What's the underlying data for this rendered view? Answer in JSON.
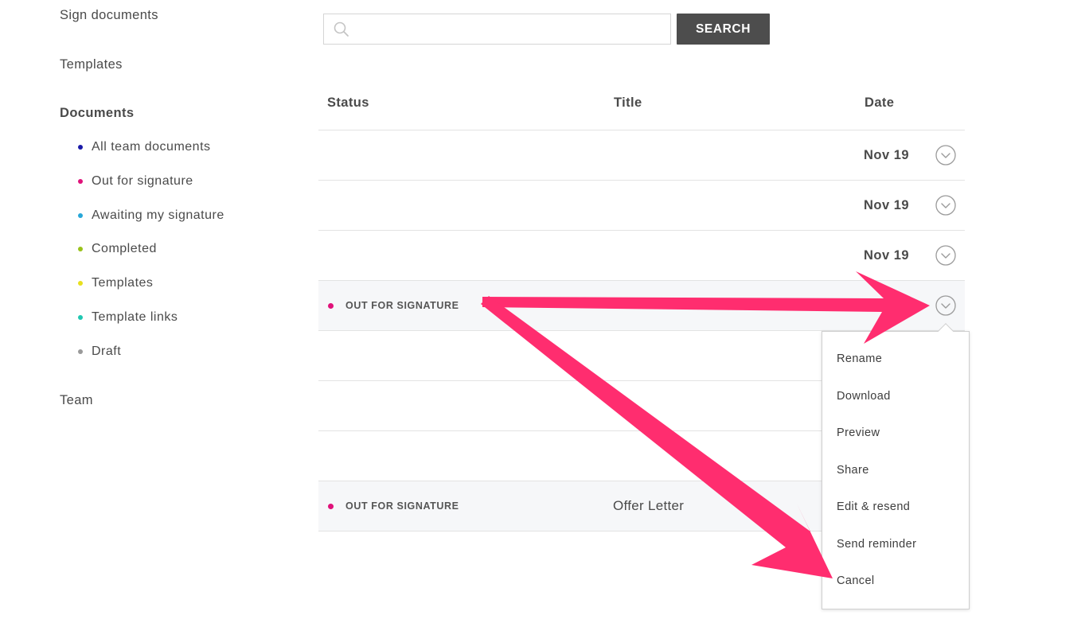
{
  "sidebar": {
    "sign_documents": "Sign documents",
    "templates": "Templates",
    "documents_heading": "Documents",
    "items": [
      {
        "label": "All team documents",
        "color": "#1a1aa8"
      },
      {
        "label": "Out for signature",
        "color": "#e0127a"
      },
      {
        "label": "Awaiting my signature",
        "color": "#27a7d8"
      },
      {
        "label": "Completed",
        "color": "#99c21a"
      },
      {
        "label": "Templates",
        "color": "#e8e01e"
      },
      {
        "label": "Template links",
        "color": "#1fc7b1"
      },
      {
        "label": "Draft",
        "color": "#9a9a9a"
      }
    ],
    "team": "Team"
  },
  "search": {
    "placeholder": "",
    "value": "",
    "button_label": "SEARCH",
    "icon": "search-icon"
  },
  "table": {
    "headers": {
      "status": "Status",
      "title": "Title",
      "date": "Date"
    },
    "rows": [
      {
        "status": "",
        "title": "",
        "date": "Nov 19",
        "has_menu": true
      },
      {
        "status": "",
        "title": "",
        "date": "Nov 19",
        "has_menu": true
      },
      {
        "status": "",
        "title": "",
        "date": "Nov 19",
        "has_menu": true
      },
      {
        "status": "OUT FOR SIGNATURE",
        "title": "",
        "date": "",
        "has_menu": true,
        "shaded": true
      },
      {
        "status": "",
        "title": "",
        "date": ""
      },
      {
        "status": "",
        "title": "",
        "date": ""
      },
      {
        "status": "",
        "title": "",
        "date": ""
      },
      {
        "status": "OUT FOR SIGNATURE",
        "title": "Offer Letter",
        "date": "",
        "shaded": true
      },
      {
        "status": "",
        "title": "",
        "date": ""
      }
    ],
    "status_color": "#e0127a"
  },
  "row_menu": {
    "items": [
      "Rename",
      "Download",
      "Preview",
      "Share",
      "Edit & resend",
      "Send reminder",
      "Cancel"
    ]
  },
  "annotation": {
    "arrow_color": "#ff2d6f"
  }
}
